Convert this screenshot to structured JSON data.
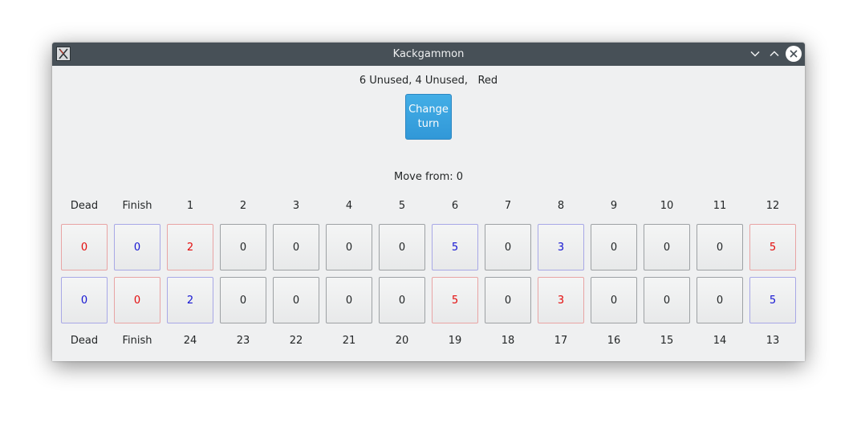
{
  "window": {
    "title": "Kackgammon"
  },
  "status": {
    "text": "6 Unused, 4 Unused,   Red"
  },
  "change_turn": {
    "label": "Change turn"
  },
  "move_from": {
    "text": "Move from: 0"
  },
  "top_labels": [
    "Dead",
    "Finish",
    "1",
    "2",
    "3",
    "4",
    "5",
    "6",
    "7",
    "8",
    "9",
    "10",
    "11",
    "12"
  ],
  "top_cells": [
    {
      "value": "0",
      "color": "red"
    },
    {
      "value": "0",
      "color": "blue"
    },
    {
      "value": "2",
      "color": "red"
    },
    {
      "value": "0",
      "color": "none"
    },
    {
      "value": "0",
      "color": "none"
    },
    {
      "value": "0",
      "color": "none"
    },
    {
      "value": "0",
      "color": "none"
    },
    {
      "value": "5",
      "color": "blue"
    },
    {
      "value": "0",
      "color": "none"
    },
    {
      "value": "3",
      "color": "blue"
    },
    {
      "value": "0",
      "color": "none"
    },
    {
      "value": "0",
      "color": "none"
    },
    {
      "value": "0",
      "color": "none"
    },
    {
      "value": "5",
      "color": "red"
    }
  ],
  "bottom_cells": [
    {
      "value": "0",
      "color": "blue"
    },
    {
      "value": "0",
      "color": "red"
    },
    {
      "value": "2",
      "color": "blue"
    },
    {
      "value": "0",
      "color": "none"
    },
    {
      "value": "0",
      "color": "none"
    },
    {
      "value": "0",
      "color": "none"
    },
    {
      "value": "0",
      "color": "none"
    },
    {
      "value": "5",
      "color": "red"
    },
    {
      "value": "0",
      "color": "none"
    },
    {
      "value": "3",
      "color": "red"
    },
    {
      "value": "0",
      "color": "none"
    },
    {
      "value": "0",
      "color": "none"
    },
    {
      "value": "0",
      "color": "none"
    },
    {
      "value": "5",
      "color": "blue"
    }
  ],
  "bottom_labels": [
    "Dead",
    "Finish",
    "24",
    "23",
    "22",
    "21",
    "20",
    "19",
    "18",
    "17",
    "16",
    "15",
    "14",
    "13"
  ],
  "colors": {
    "red": "#e30b0b",
    "blue": "#1414d2",
    "accent": "#3daee9",
    "titlebar": "#475057"
  }
}
